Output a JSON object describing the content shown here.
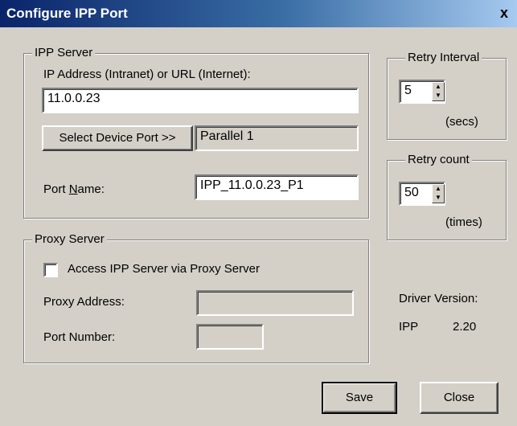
{
  "window": {
    "title": "Configure IPP Port",
    "close_glyph": "x"
  },
  "ipp_server": {
    "legend": "IPP Server",
    "address_label": "IP Address (Intranet) or URL (Internet):",
    "address_value": "11.0.0.23",
    "select_device_button": "Select Device Port >>",
    "device_port_value": "Parallel 1",
    "port_name_label_pre": "Port ",
    "port_name_label_ul": "N",
    "port_name_label_post": "ame:",
    "port_name_value": "IPP_11.0.0.23_P1"
  },
  "retry_interval": {
    "legend": "Retry Interval",
    "value": "5",
    "unit": "(secs)"
  },
  "retry_count": {
    "legend": "Retry count",
    "value": "50",
    "unit": "(times)"
  },
  "proxy_server": {
    "legend": "Proxy Server",
    "checkbox_label": "Access IPP Server via Proxy Server",
    "checked": false,
    "proxy_address_label": "Proxy Address:",
    "proxy_address_value": "",
    "port_number_label": "Port Number:",
    "port_number_value": ""
  },
  "driver": {
    "label": "Driver Version:",
    "name": "IPP",
    "version": "2.20"
  },
  "buttons": {
    "save": "Save",
    "close": "Close"
  },
  "icons": {
    "spin_up": "up-arrow-icon",
    "spin_down": "down-arrow-icon"
  }
}
